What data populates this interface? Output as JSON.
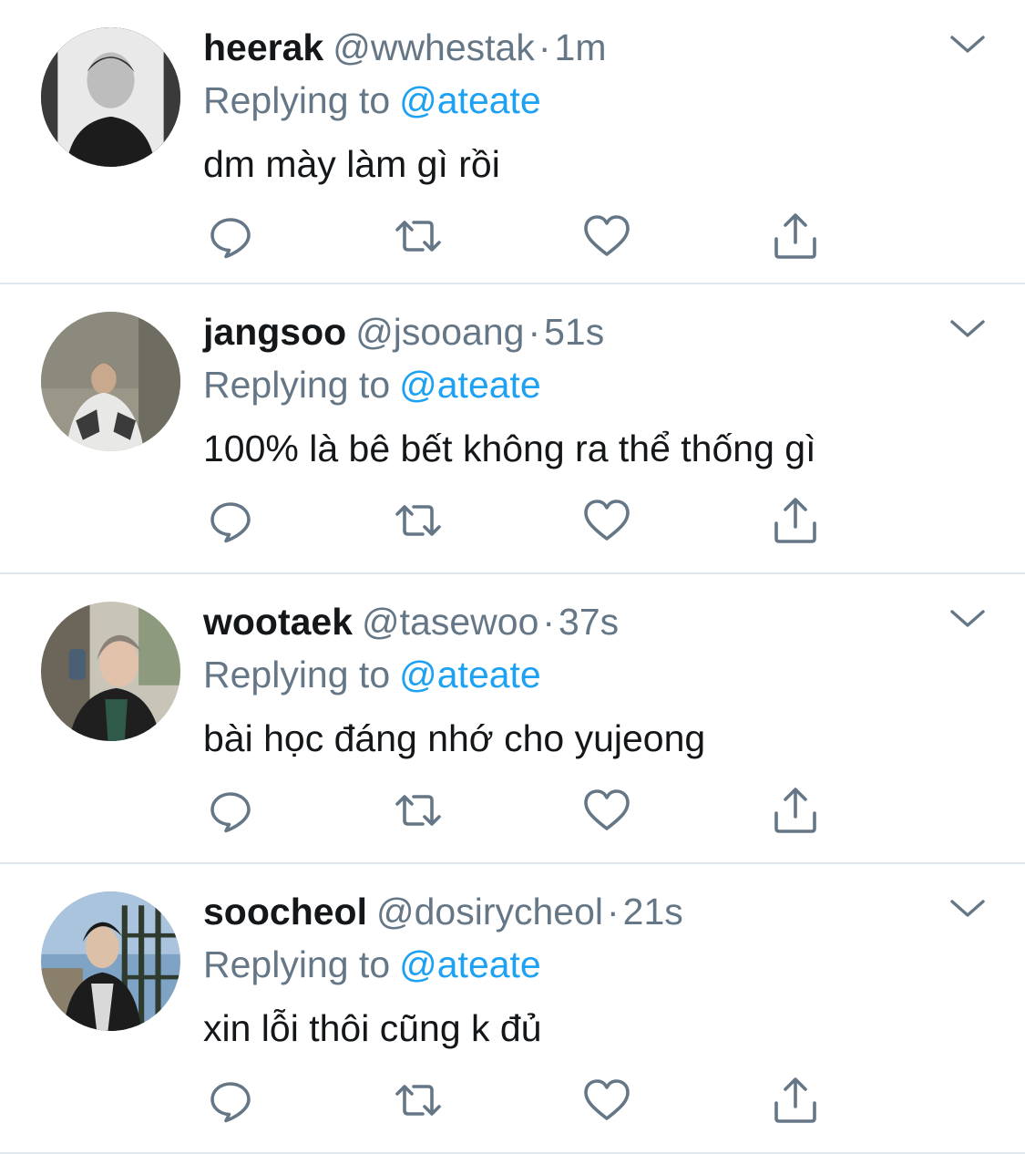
{
  "tweets": [
    {
      "display_name": "heerak",
      "handle": "@wwhestak",
      "separator": "·",
      "time": "1m",
      "reply_prefix": "Replying to",
      "reply_to": "@ateate",
      "text": "dm mày làm gì rồi"
    },
    {
      "display_name": "jangsoo",
      "handle": "@jsooang",
      "separator": "·",
      "time": "51s",
      "reply_prefix": "Replying to",
      "reply_to": "@ateate",
      "text": "100% là bê bết không ra thể thống gì"
    },
    {
      "display_name": "wootaek",
      "handle": "@tasewoo",
      "separator": "·",
      "time": "37s",
      "reply_prefix": "Replying to",
      "reply_to": "@ateate",
      "text": "bài học đáng nhớ cho yujeong"
    },
    {
      "display_name": "soocheol",
      "handle": "@dosirycheol",
      "separator": "·",
      "time": "21s",
      "reply_prefix": "Replying to",
      "reply_to": "@ateate",
      "text": "xin lỗi thôi cũng k đủ"
    }
  ],
  "icons": {
    "reply": "reply-icon",
    "retweet": "retweet-icon",
    "like": "heart-icon",
    "share": "share-icon",
    "menu": "chevron-down-icon"
  },
  "colors": {
    "text_primary": "#14171a",
    "text_secondary": "#657786",
    "link": "#1da1f2",
    "divider": "#e1e8ed"
  }
}
